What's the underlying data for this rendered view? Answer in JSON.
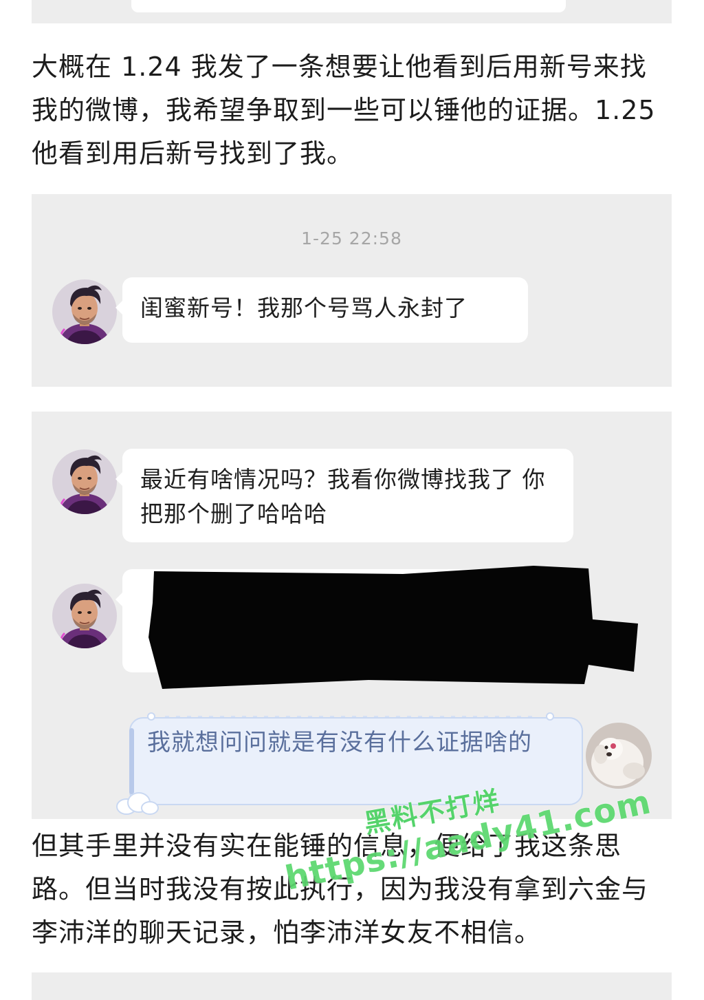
{
  "paragraphs": {
    "first": "大概在 1.24 我发了一条想要让他看到后用新号来找我的微博，我希望争取到一些可以锤他的证据。1.25 他看到用后新号找到了我。",
    "second": "但其手里并没有实在能锤的信息，便给了我这条思路。但当时我没有按此执行，因为我没有拿到六金与李沛洋的聊天记录，怕李沛洋女友不相信。"
  },
  "chat1": {
    "timestamp": "1-25 22:58",
    "messages": [
      {
        "text": "闺蜜新号！我那个号骂人永封了"
      }
    ]
  },
  "chat2": {
    "messages": [
      {
        "text": "最近有啥情况吗？我看你微博找我了 你把那个删了哈哈哈"
      },
      {
        "text": "我就想问问就是有没有什么证据啥的"
      }
    ]
  },
  "watermark": {
    "title": "黑料不打烊",
    "url": "https://aady41.com"
  },
  "colors": {
    "panel_bg": "#ededed",
    "bubble_bg": "#ffffff",
    "own_bubble_bg": "#eaf0fb",
    "watermark": "#5bd86e"
  },
  "icons": {
    "avatar_other": "man-portrait-avatar",
    "avatar_self": "white-dog-avatar",
    "redaction": "black-redaction-mark"
  }
}
